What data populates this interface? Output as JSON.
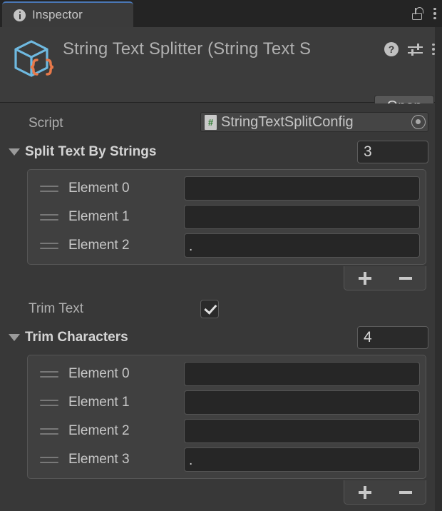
{
  "window": {
    "tab": {
      "label": "Inspector",
      "icon": "info-circle-icon"
    },
    "lock_icon": "unlocked-padlock-icon",
    "menu_icon": "kebab-menu-icon"
  },
  "object_header": {
    "icon": "scriptable-object-icon",
    "title": "String Text Splitter (String Text S",
    "help_label": "?",
    "help_icon": "help-icon",
    "preset_icon": "preset-sliders-icon",
    "menu_icon": "kebab-menu-icon",
    "open_button": "Open"
  },
  "script_row": {
    "label": "Script",
    "value": "StringTextSplitConfig",
    "type_icon": "cs-script-icon",
    "type_icon_glyph": "#",
    "picker_icon": "object-picker-icon"
  },
  "sections": [
    {
      "title": "Split Text By Strings",
      "size": "3",
      "expanded": true,
      "elements": [
        {
          "label": "Element 0",
          "value": ""
        },
        {
          "label": "Element 1",
          "value": ""
        },
        {
          "label": "Element 2",
          "value": "."
        }
      ],
      "footer": {
        "add": "+",
        "remove": "−"
      }
    },
    {
      "title": "Trim Characters",
      "size": "4",
      "expanded": true,
      "elements": [
        {
          "label": "Element 0",
          "value": ""
        },
        {
          "label": "Element 1",
          "value": ""
        },
        {
          "label": "Element 2",
          "value": ""
        },
        {
          "label": "Element 3",
          "value": "."
        }
      ],
      "footer": {
        "add": "+",
        "remove": "−"
      }
    }
  ],
  "trim_text": {
    "label": "Trim Text",
    "checked": true
  },
  "colors": {
    "tab_accent": "#4a77b5",
    "window_bg": "#383838",
    "header_bg": "#3c3c3c",
    "tabbar_bg": "#242424",
    "so_icon_cube": "#6fb9e0",
    "so_icon_braces": "#e8794a",
    "cs_glyph": "#2f7d32"
  }
}
